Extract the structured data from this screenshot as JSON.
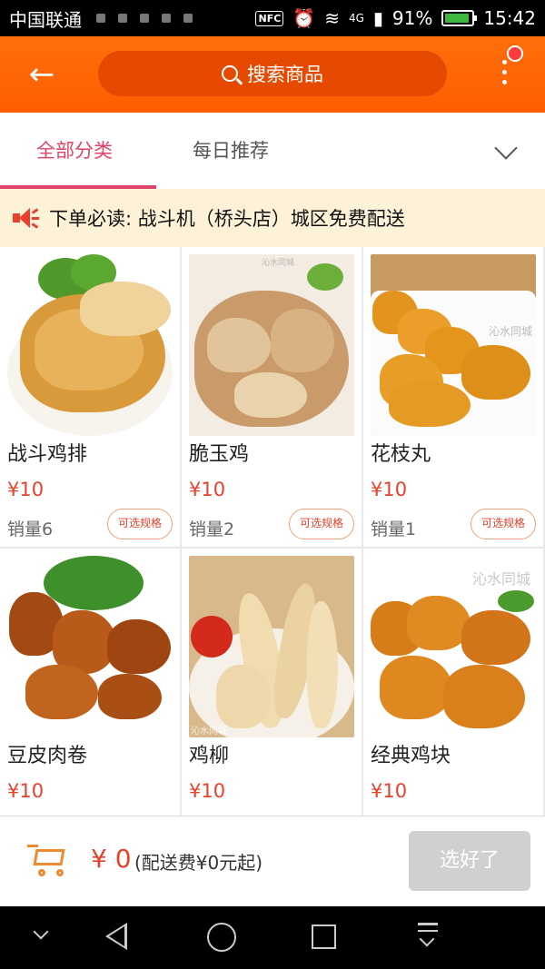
{
  "status_bar": {
    "carrier": "中国联通",
    "nfc": "NFC",
    "network": "4G",
    "battery": "91%",
    "time": "15:42"
  },
  "header": {
    "back_icon": "arrow-left-icon",
    "search_placeholder": "搜索商品",
    "more_icon": "more-vertical-icon"
  },
  "tabs": [
    {
      "label": "全部分类",
      "active": true
    },
    {
      "label": "每日推荐",
      "active": false
    }
  ],
  "notice": {
    "text": "下单必读: 战斗机（桥头店）城区免费配送"
  },
  "products": [
    {
      "name": "战斗鸡排",
      "price": "¥10",
      "sales": "销量6",
      "spec_label": "可选规格"
    },
    {
      "name": "脆玉鸡",
      "price": "¥10",
      "sales": "销量2",
      "spec_label": "可选规格"
    },
    {
      "name": "花枝丸",
      "price": "¥10",
      "sales": "销量1",
      "spec_label": "可选规格"
    },
    {
      "name": "豆皮肉卷",
      "price": "¥10",
      "sales": "",
      "spec_label": ""
    },
    {
      "name": "鸡柳",
      "price": "¥10",
      "sales": "",
      "spec_label": ""
    },
    {
      "name": "经典鸡块",
      "price": "¥10",
      "sales": "",
      "spec_label": ""
    }
  ],
  "watermark": "沁水同城",
  "cart": {
    "total": "¥ 0",
    "delivery_note": "(配送费¥0元起)",
    "submit_label": "选好了"
  },
  "colors": {
    "brand": "#ff6a00",
    "accent": "#e0436a",
    "price": "#e8412b"
  }
}
